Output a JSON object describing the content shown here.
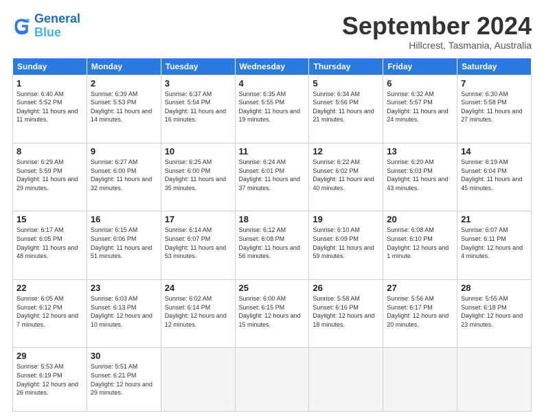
{
  "logo": {
    "text_general": "General",
    "text_blue": "Blue"
  },
  "header": {
    "month_year": "September 2024",
    "location": "Hillcrest, Tasmania, Australia"
  },
  "days_of_week": [
    "Sunday",
    "Monday",
    "Tuesday",
    "Wednesday",
    "Thursday",
    "Friday",
    "Saturday"
  ],
  "weeks": [
    [
      {
        "day": "1",
        "sunrise": "6:40 AM",
        "sunset": "5:52 PM",
        "daylight": "11 hours and 11 minutes."
      },
      {
        "day": "2",
        "sunrise": "6:39 AM",
        "sunset": "5:53 PM",
        "daylight": "11 hours and 14 minutes."
      },
      {
        "day": "3",
        "sunrise": "6:37 AM",
        "sunset": "5:54 PM",
        "daylight": "11 hours and 16 minutes."
      },
      {
        "day": "4",
        "sunrise": "6:35 AM",
        "sunset": "5:55 PM",
        "daylight": "11 hours and 19 minutes."
      },
      {
        "day": "5",
        "sunrise": "6:34 AM",
        "sunset": "5:56 PM",
        "daylight": "11 hours and 21 minutes."
      },
      {
        "day": "6",
        "sunrise": "6:32 AM",
        "sunset": "5:57 PM",
        "daylight": "11 hours and 24 minutes."
      },
      {
        "day": "7",
        "sunrise": "6:30 AM",
        "sunset": "5:58 PM",
        "daylight": "11 hours and 27 minutes."
      }
    ],
    [
      {
        "day": "8",
        "sunrise": "6:29 AM",
        "sunset": "5:59 PM",
        "daylight": "11 hours and 29 minutes."
      },
      {
        "day": "9",
        "sunrise": "6:27 AM",
        "sunset": "6:00 PM",
        "daylight": "11 hours and 32 minutes."
      },
      {
        "day": "10",
        "sunrise": "6:25 AM",
        "sunset": "6:00 PM",
        "daylight": "11 hours and 35 minutes."
      },
      {
        "day": "11",
        "sunrise": "6:24 AM",
        "sunset": "6:01 PM",
        "daylight": "11 hours and 37 minutes."
      },
      {
        "day": "12",
        "sunrise": "6:22 AM",
        "sunset": "6:02 PM",
        "daylight": "11 hours and 40 minutes."
      },
      {
        "day": "13",
        "sunrise": "6:20 AM",
        "sunset": "6:03 PM",
        "daylight": "11 hours and 43 minutes."
      },
      {
        "day": "14",
        "sunrise": "6:19 AM",
        "sunset": "6:04 PM",
        "daylight": "11 hours and 45 minutes."
      }
    ],
    [
      {
        "day": "15",
        "sunrise": "6:17 AM",
        "sunset": "6:05 PM",
        "daylight": "11 hours and 48 minutes."
      },
      {
        "day": "16",
        "sunrise": "6:15 AM",
        "sunset": "6:06 PM",
        "daylight": "11 hours and 51 minutes."
      },
      {
        "day": "17",
        "sunrise": "6:14 AM",
        "sunset": "6:07 PM",
        "daylight": "11 hours and 53 minutes."
      },
      {
        "day": "18",
        "sunrise": "6:12 AM",
        "sunset": "6:08 PM",
        "daylight": "11 hours and 56 minutes."
      },
      {
        "day": "19",
        "sunrise": "6:10 AM",
        "sunset": "6:09 PM",
        "daylight": "11 hours and 59 minutes."
      },
      {
        "day": "20",
        "sunrise": "6:08 AM",
        "sunset": "6:10 PM",
        "daylight": "12 hours and 1 minute."
      },
      {
        "day": "21",
        "sunrise": "6:07 AM",
        "sunset": "6:11 PM",
        "daylight": "12 hours and 4 minutes."
      }
    ],
    [
      {
        "day": "22",
        "sunrise": "6:05 AM",
        "sunset": "6:12 PM",
        "daylight": "12 hours and 7 minutes."
      },
      {
        "day": "23",
        "sunrise": "6:03 AM",
        "sunset": "6:13 PM",
        "daylight": "12 hours and 10 minutes."
      },
      {
        "day": "24",
        "sunrise": "6:02 AM",
        "sunset": "6:14 PM",
        "daylight": "12 hours and 12 minutes."
      },
      {
        "day": "25",
        "sunrise": "6:00 AM",
        "sunset": "6:15 PM",
        "daylight": "12 hours and 15 minutes."
      },
      {
        "day": "26",
        "sunrise": "5:58 AM",
        "sunset": "6:16 PM",
        "daylight": "12 hours and 18 minutes."
      },
      {
        "day": "27",
        "sunrise": "5:56 AM",
        "sunset": "6:17 PM",
        "daylight": "12 hours and 20 minutes."
      },
      {
        "day": "28",
        "sunrise": "5:55 AM",
        "sunset": "6:18 PM",
        "daylight": "12 hours and 23 minutes."
      }
    ],
    [
      {
        "day": "29",
        "sunrise": "5:53 AM",
        "sunset": "6:19 PM",
        "daylight": "12 hours and 26 minutes."
      },
      {
        "day": "30",
        "sunrise": "5:51 AM",
        "sunset": "6:21 PM",
        "daylight": "12 hours and 29 minutes."
      },
      null,
      null,
      null,
      null,
      null
    ]
  ]
}
